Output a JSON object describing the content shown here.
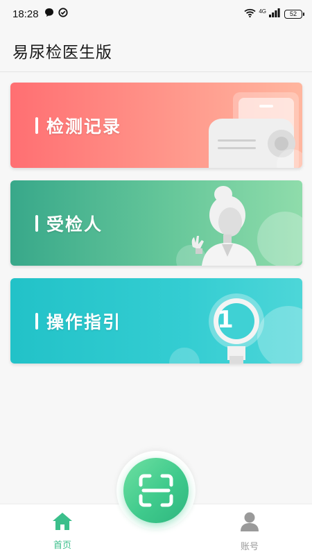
{
  "status_bar": {
    "time": "18:28",
    "network": "4G",
    "battery": "52"
  },
  "header": {
    "title": "易尿检医生版"
  },
  "cards": [
    {
      "label": "检测记录",
      "color": "#ff8a82"
    },
    {
      "label": "受检人",
      "color": "#52b892"
    },
    {
      "label": "操作指引",
      "color": "#2fc8cd"
    }
  ],
  "guide_badge": "1",
  "bottom_nav": {
    "home_label": "首页",
    "account_label": "账号",
    "active_color": "#3bbf8b",
    "inactive_color": "#9a9a9a"
  },
  "icons": {
    "scan": "scan-icon",
    "home": "home-icon",
    "account": "person-icon"
  }
}
